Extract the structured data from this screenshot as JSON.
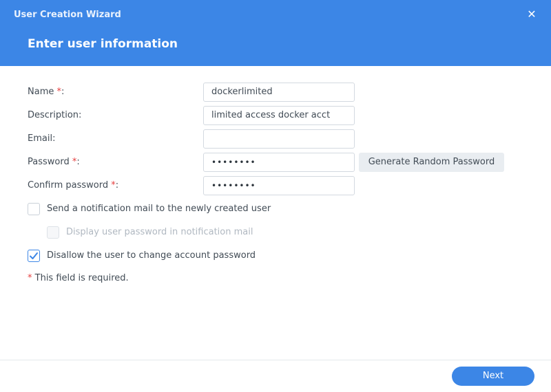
{
  "window": {
    "title": "User Creation Wizard",
    "close_symbol": "✕",
    "step_title": "Enter user information"
  },
  "form": {
    "required_mark": "*",
    "fields": [
      {
        "label": "Name ",
        "suffix": ":",
        "required": true,
        "value": "dockerlimited"
      },
      {
        "label": "Description:",
        "required": false,
        "value": "limited access docker acct"
      },
      {
        "label": "Email:",
        "required": false,
        "value": ""
      },
      {
        "label": "Password ",
        "suffix": ":",
        "required": true,
        "value": "••••••••"
      },
      {
        "label": "Confirm password ",
        "suffix": ":",
        "required": true,
        "value": "••••••••"
      }
    ],
    "generate_password_label": "Generate Random Password"
  },
  "options": [
    {
      "label": "Send a notification mail to the newly created user",
      "checked": false,
      "disabled": false
    },
    {
      "label": "Display user password in notification mail",
      "checked": false,
      "disabled": true
    },
    {
      "label": "Disallow the user to change account password",
      "checked": true,
      "disabled": false
    }
  ],
  "required_note": {
    "mark": "*",
    "text": " This field is required."
  },
  "footer": {
    "next_label": "Next"
  },
  "colors": {
    "header_bg": "#3c86e6",
    "required": "#e64040",
    "check": "#3c86e6"
  },
  "icons": {
    "close": "close-icon",
    "check": "checkmark-icon"
  }
}
